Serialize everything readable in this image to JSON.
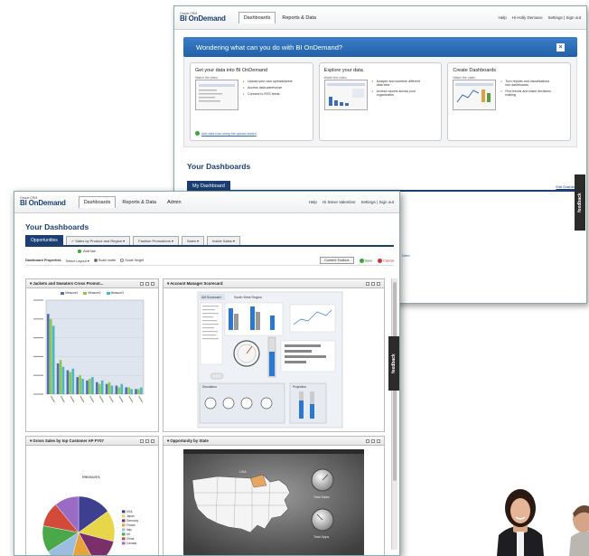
{
  "back_window": {
    "logo_small": "Oracle CRM",
    "logo_big": "BI OnDemand",
    "nav_tabs": [
      "Dashboards",
      "Reports & Data"
    ],
    "top_links": [
      "Help",
      "Hi Holly Demano",
      "Settings | Sign out"
    ],
    "banner_text": "Wondering what can you do with BI OnDemand?",
    "banner_close": "×",
    "cards": [
      {
        "title": "Get your data into BI OnDemand",
        "video_label": "Watch the video",
        "bullets": [
          "Upload your own spreadsheets",
          "Access data warehouse",
          "Connect to RSS feeds"
        ],
        "link": "Add data now using the upload wizard"
      },
      {
        "title": "Explore your data",
        "video_label": "Watch the video",
        "bullets": [
          "Analyze and combine different data sets",
          "Access reports across your organization"
        ]
      },
      {
        "title": "Create Dashboards",
        "video_label": "Watch the video",
        "bullets": [
          "Turn reports and visualizations into dashboards",
          "Find trends and make decisions making"
        ]
      }
    ],
    "dashboards_title": "Your Dashboards",
    "my_dashboard_tab": "My Dashboard",
    "edit_dashboard": "Edit Dashboard",
    "sales_link": "Sales",
    "feedback": "feedback"
  },
  "front_window": {
    "logo_small": "Oracle CRM",
    "logo_big": "BI OnDemand",
    "nav_tabs": [
      "Dashboards",
      "Reports & Data",
      "Admin"
    ],
    "top_links": [
      "Help",
      "Hi Steve Valentine",
      "Settings | Sign out"
    ],
    "dashboards_title": "Your Dashboards",
    "tabs": [
      "Opportunities",
      "Sales by Product and Region",
      "Fashion Promotions",
      "Sales",
      "Inside Sales"
    ],
    "add_tab": "Add tab",
    "props": {
      "label": "Dashboard Properties",
      "select_layout": "Select Layout",
      "scale_width": "Scale width",
      "scale_height": "Scale height",
      "toolbox": "Content Toolbox",
      "save": "Save",
      "cancel": "Cancel"
    },
    "panels": {
      "p1": "Jackets and Sweaters Cross Promot...",
      "p2": "Account Manager Scorecard",
      "p3": "Gross Sales by top Customer AP FY07",
      "p4": "Opportunity by State"
    },
    "scorecard": {
      "tab1": "AM Scorecard",
      "tab2": "South West Region",
      "simulation": "Simulation",
      "projection": "Projection"
    },
    "p1_legend": [
      "Measure1",
      "Measure2",
      "Measure3"
    ],
    "pie_title": "Measure1",
    "pie_legend": [
      "USA",
      "Japan",
      "Germany",
      "France",
      "Italy",
      "UK",
      "China",
      "Canada"
    ],
    "map_label": "USA",
    "map_gauges": [
      "Total Sales",
      "Total Opps"
    ],
    "feedback": "feedback"
  },
  "colors": {
    "brand_navy": "#1b3f73",
    "banner_blue": "#2a6ab4",
    "bar_series": [
      "#4f6fb0",
      "#8cc84b",
      "#4cb7c7"
    ],
    "pie": [
      "#3d3f8f",
      "#e8d64a",
      "#7a2f6b",
      "#e6a33a",
      "#9bbde0",
      "#4aa84a",
      "#d14a3a",
      "#9a6bc4"
    ]
  },
  "chart_data": [
    {
      "type": "bar",
      "title": "",
      "series": [
        {
          "name": "Measure1",
          "values": [
            47,
            18,
            14,
            10,
            8,
            7,
            6,
            5,
            4,
            3
          ]
        },
        {
          "name": "Measure2",
          "values": [
            44,
            20,
            13,
            11,
            9,
            6,
            7,
            4,
            4,
            3
          ]
        },
        {
          "name": "Measure3",
          "values": [
            40,
            16,
            15,
            9,
            10,
            8,
            5,
            6,
            3,
            4
          ]
        }
      ],
      "ylim": [
        0,
        55
      ]
    },
    {
      "type": "pie",
      "title": "Measure1",
      "categories": [
        "USA",
        "Japan",
        "Germany",
        "France",
        "Italy",
        "UK",
        "China",
        "Canada"
      ],
      "values": [
        15,
        14,
        13,
        12,
        12,
        12,
        11,
        11
      ]
    }
  ]
}
